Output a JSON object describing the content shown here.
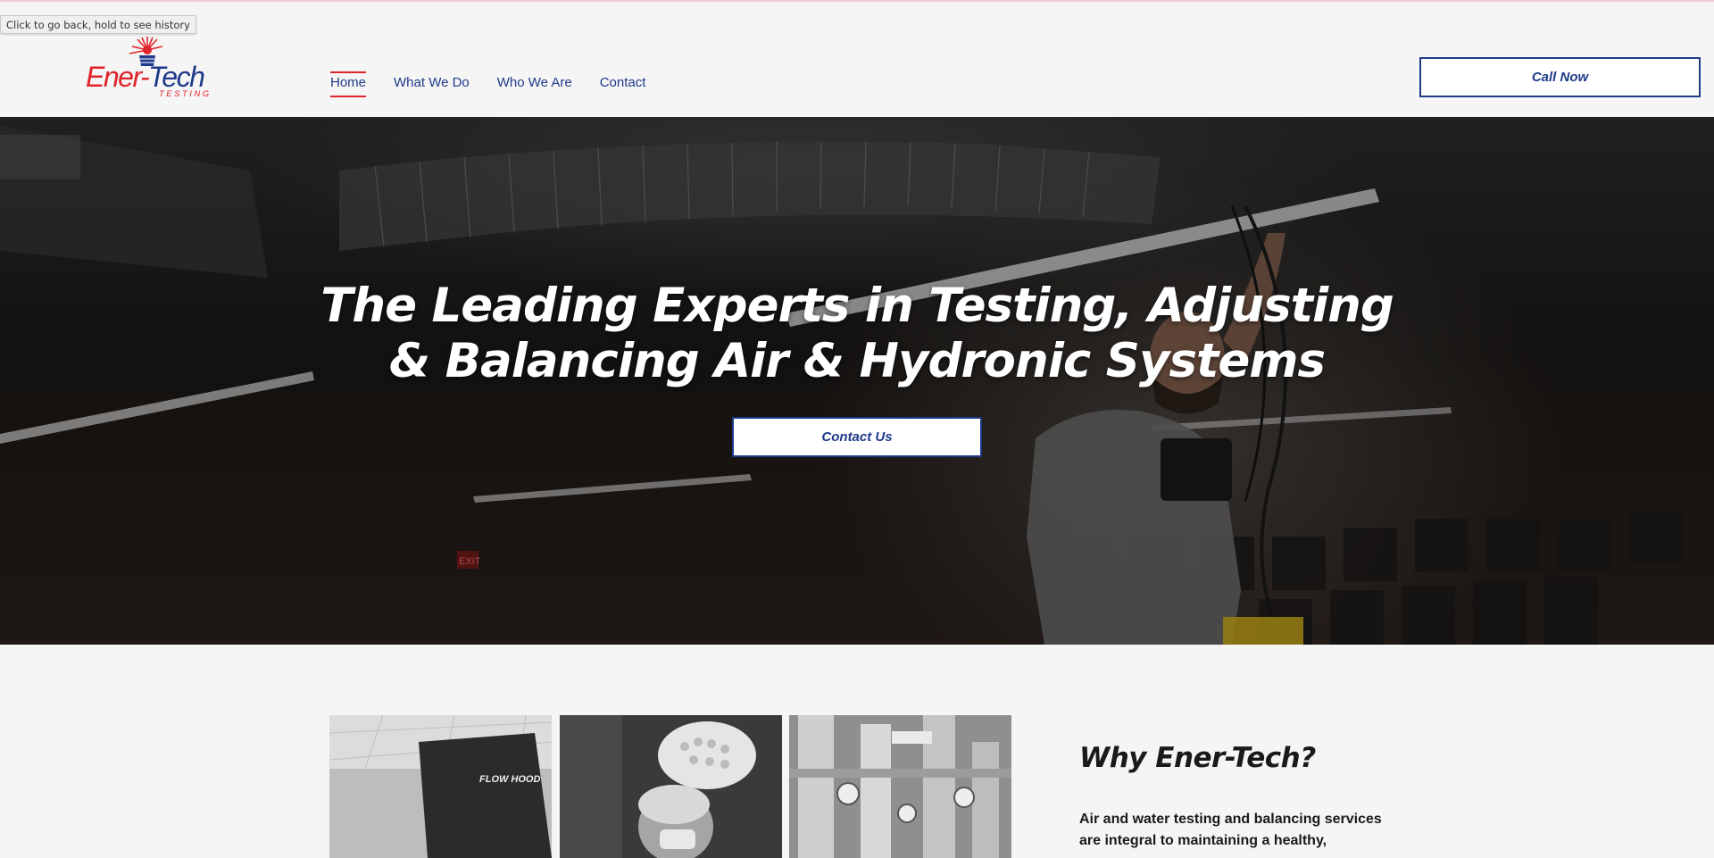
{
  "tooltip": "Click to go back, hold to see history",
  "logo": {
    "word_part1": "Ener-",
    "word_part2": "Tech",
    "sub": "TESTING"
  },
  "nav": {
    "items": [
      {
        "label": "Home"
      },
      {
        "label": "What We Do"
      },
      {
        "label": "Who We Are"
      },
      {
        "label": "Contact"
      }
    ]
  },
  "header": {
    "cta_label": "Call Now"
  },
  "hero": {
    "title_line1": "The Leading Experts in Testing, Adjusting",
    "title_line2": "& Balancing Air & Hydronic Systems",
    "cta_label": "Contact Us"
  },
  "why": {
    "title": "Why Ener-Tech?",
    "body": "Air and water testing and balancing services are integral to maintaining a healthy,"
  },
  "colors": {
    "brand_blue": "#1f3a8a",
    "brand_red": "#e0242b",
    "page_bg": "#f5f5f5"
  },
  "photos": [
    {
      "icon": "fume-hood-photo"
    },
    {
      "icon": "surgeon-photo"
    },
    {
      "icon": "mechanical-room-photo"
    }
  ]
}
